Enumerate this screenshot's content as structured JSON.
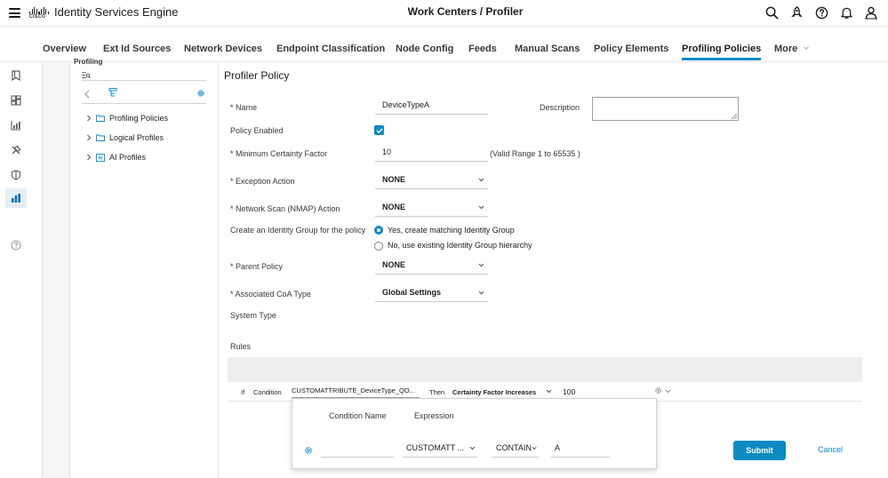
{
  "header": {
    "app_title": "Identity Services Engine",
    "logo_text": "CISCO",
    "page_heading": "Work Centers / Profiler",
    "icons": [
      "search-icon",
      "rocket-icon",
      "help-icon",
      "bell-icon",
      "user-icon"
    ]
  },
  "tabs": [
    {
      "label": "Overview"
    },
    {
      "label": "Ext Id Sources"
    },
    {
      "label": "Network Devices"
    },
    {
      "label": "Endpoint Classification"
    },
    {
      "label": "Node Config"
    },
    {
      "label": "Feeds"
    },
    {
      "label": "Manual Scans"
    },
    {
      "label": "Policy Elements"
    },
    {
      "label": "Profiling Policies",
      "active": true
    },
    {
      "label": "More"
    }
  ],
  "tree": {
    "header_fragment": "Profiling",
    "items": [
      {
        "label": "Profiling Policies",
        "icon": "folder-icon"
      },
      {
        "label": "Logical Profiles",
        "icon": "folder-icon"
      },
      {
        "label": "AI Profiles",
        "icon": "ai-icon"
      }
    ]
  },
  "form": {
    "title": "Profiler Policy",
    "name_label": "* Name",
    "name_value": "DeviceTypeA",
    "description_label": "Description",
    "description_value": "",
    "policy_enabled_label": "Policy Enabled",
    "policy_enabled": true,
    "min_cf_label": "* Minimum Certainty Factor",
    "min_cf_value": "10",
    "min_cf_hint": "(Valid Range 1 to 65535 )",
    "exception_label": "* Exception Action",
    "exception_value": "NONE",
    "nmap_label": "* Network Scan (NMAP) Action",
    "nmap_value": "NONE",
    "identity_group_label": "Create an Identity Group for the policy",
    "radio_yes": "Yes, create matching Identity Group",
    "radio_no": "No, use existing Identity Group hierarchy",
    "parent_label": "* Parent Policy",
    "parent_value": "NONE",
    "coa_label": "* Associated CoA Type",
    "coa_value": "Global Settings",
    "system_type_label": "System Type"
  },
  "rules": {
    "title": "Rules",
    "row": {
      "if": "If",
      "condition_label": "Condition",
      "condition_value": "CUSTOMATTRIBUTE_DeviceType_QO...",
      "then": "Then",
      "action": "Certainty Factor Increases",
      "amount": "100"
    },
    "popover": {
      "col_name": "Condition Name",
      "col_expression": "Expression",
      "attribute": "CUSTOMATT ...",
      "operator": "CONTAIN",
      "value": "A"
    }
  },
  "actions": {
    "submit": "Submit",
    "cancel": "Cancel"
  },
  "colors": {
    "accent": "#0d8ac4"
  }
}
